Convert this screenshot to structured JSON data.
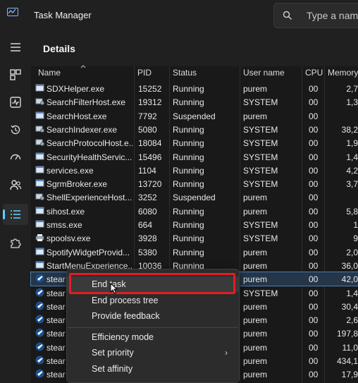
{
  "window": {
    "title": "Task Manager"
  },
  "search": {
    "placeholder": "Type a name"
  },
  "page": {
    "title": "Details"
  },
  "columns": {
    "name": "Name",
    "pid": "PID",
    "status": "Status",
    "user": "User name",
    "cpu": "CPU",
    "memory": "Memory"
  },
  "processes": [
    {
      "name": "SDXHelper.exe",
      "pid": "15252",
      "status": "Running",
      "user": "purem",
      "cpu": "00",
      "mem": "2,7",
      "icon": "app-window-icon"
    },
    {
      "name": "SearchFilterHost.exe",
      "pid": "19312",
      "status": "Running",
      "user": "SYSTEM",
      "cpu": "00",
      "mem": "1,3",
      "icon": "system-process-icon"
    },
    {
      "name": "SearchHost.exe",
      "pid": "7792",
      "status": "Suspended",
      "user": "purem",
      "cpu": "00",
      "mem": "",
      "icon": "app-window-icon"
    },
    {
      "name": "SearchIndexer.exe",
      "pid": "5080",
      "status": "Running",
      "user": "SYSTEM",
      "cpu": "00",
      "mem": "38,2",
      "icon": "system-process-icon"
    },
    {
      "name": "SearchProtocolHost.e...",
      "pid": "18084",
      "status": "Running",
      "user": "SYSTEM",
      "cpu": "00",
      "mem": "1,9",
      "icon": "system-process-icon"
    },
    {
      "name": "SecurityHealthServic...",
      "pid": "15496",
      "status": "Running",
      "user": "SYSTEM",
      "cpu": "00",
      "mem": "1,4",
      "icon": "app-window-icon"
    },
    {
      "name": "services.exe",
      "pid": "1104",
      "status": "Running",
      "user": "SYSTEM",
      "cpu": "00",
      "mem": "4,2",
      "icon": "app-window-icon"
    },
    {
      "name": "SgrmBroker.exe",
      "pid": "13720",
      "status": "Running",
      "user": "SYSTEM",
      "cpu": "00",
      "mem": "3,7",
      "icon": "app-window-icon"
    },
    {
      "name": "ShellExperienceHost....",
      "pid": "3252",
      "status": "Suspended",
      "user": "purem",
      "cpu": "00",
      "mem": "",
      "icon": "system-process-icon"
    },
    {
      "name": "sihost.exe",
      "pid": "6080",
      "status": "Running",
      "user": "purem",
      "cpu": "00",
      "mem": "5,8",
      "icon": "app-window-icon"
    },
    {
      "name": "smss.exe",
      "pid": "664",
      "status": "Running",
      "user": "SYSTEM",
      "cpu": "00",
      "mem": "1",
      "icon": "app-window-icon"
    },
    {
      "name": "spoolsv.exe",
      "pid": "3928",
      "status": "Running",
      "user": "SYSTEM",
      "cpu": "00",
      "mem": "9",
      "icon": "printer-icon"
    },
    {
      "name": "SpotifyWidgetProvid...",
      "pid": "5380",
      "status": "Running",
      "user": "purem",
      "cpu": "00",
      "mem": "2,0",
      "icon": "app-window-icon"
    },
    {
      "name": "StartMenuExperience...",
      "pid": "10036",
      "status": "Running",
      "user": "purem",
      "cpu": "00",
      "mem": "36,0",
      "icon": "app-window-icon"
    },
    {
      "name": "stear",
      "pid": "",
      "status": "",
      "user": "purem",
      "cpu": "00",
      "mem": "42,0",
      "icon": "steam-icon"
    },
    {
      "name": "stear",
      "pid": "",
      "status": "",
      "user": "SYSTEM",
      "cpu": "00",
      "mem": "1,4",
      "icon": "steam-icon"
    },
    {
      "name": "stear",
      "pid": "",
      "status": "",
      "user": "purem",
      "cpu": "00",
      "mem": "30,4",
      "icon": "steam-icon"
    },
    {
      "name": "stear",
      "pid": "",
      "status": "",
      "user": "purem",
      "cpu": "00",
      "mem": "2,6",
      "icon": "steam-icon"
    },
    {
      "name": "stear",
      "pid": "",
      "status": "",
      "user": "purem",
      "cpu": "00",
      "mem": "197,8",
      "icon": "steam-icon"
    },
    {
      "name": "stear",
      "pid": "",
      "status": "",
      "user": "purem",
      "cpu": "00",
      "mem": "11,0",
      "icon": "steam-icon"
    },
    {
      "name": "stear",
      "pid": "",
      "status": "",
      "user": "purem",
      "cpu": "00",
      "mem": "434,1",
      "icon": "steam-icon"
    },
    {
      "name": "stear",
      "pid": "",
      "status": "",
      "user": "purem",
      "cpu": "00",
      "mem": "17,9",
      "icon": "steam-icon"
    }
  ],
  "context_menu": {
    "end_task": "End task",
    "end_process_tree": "End process tree",
    "provide_feedback": "Provide feedback",
    "efficiency_mode": "Efficiency mode",
    "set_priority": "Set priority",
    "set_affinity": "Set affinity"
  },
  "colors": {
    "accent": "#60cdff",
    "highlight_box": "#e01e25",
    "selected_row": "#24364a"
  }
}
